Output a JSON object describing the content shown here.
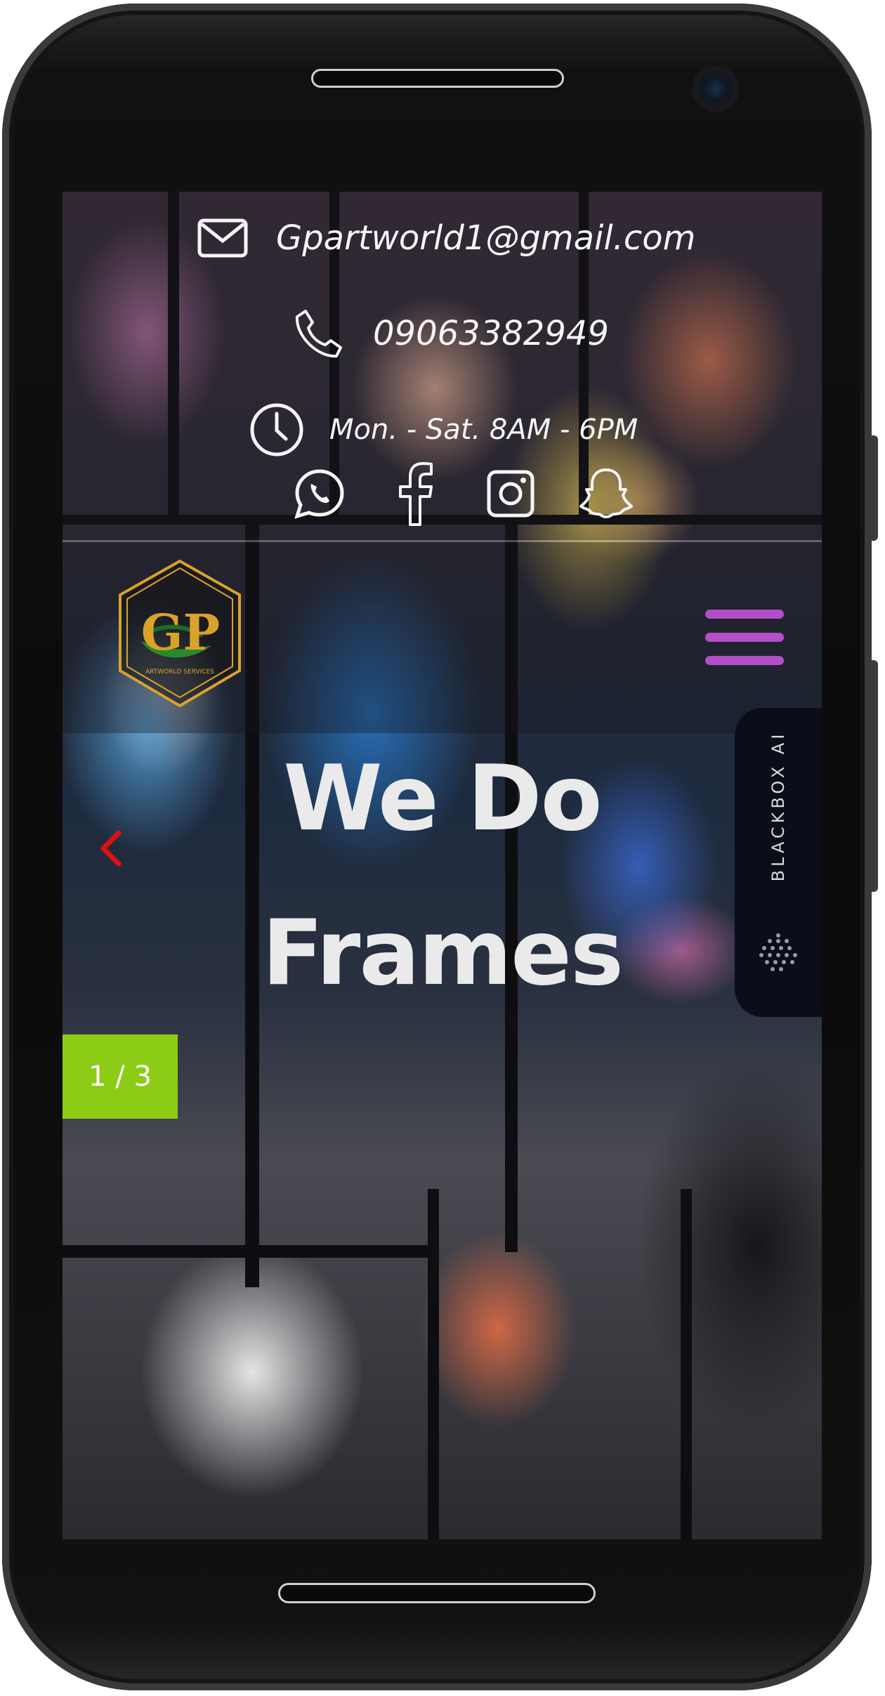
{
  "contact": {
    "email": "Gpartworld1@gmail.com",
    "phone": "09063382949",
    "hours": "Mon. - Sat. 8AM - 6PM"
  },
  "social_icons": [
    "whatsapp-icon",
    "facebook-icon",
    "instagram-icon",
    "snapchat-icon"
  ],
  "logo": {
    "letters": "GP",
    "subtitle": "ARTWORLD SERVICES"
  },
  "hero": {
    "line1": "We Do",
    "line2": "Frames"
  },
  "slider": {
    "counter": "1 / 3"
  },
  "blackbox_tab": {
    "label": "BLACKBOX AI"
  },
  "colors": {
    "menu_accent": "#b24fc8",
    "counter_bg": "#8ccc16",
    "prev_arrow": "#e01010",
    "logo_gold": "#d9a22a",
    "logo_green": "#2a8a2a"
  }
}
